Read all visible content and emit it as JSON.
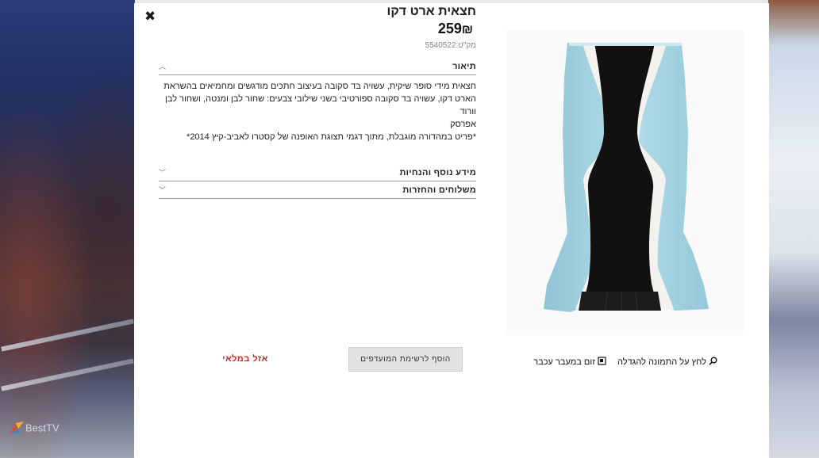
{
  "product": {
    "title": "חצאית ארט דקו",
    "price": "259",
    "currency": "₪",
    "sku": "מק\"ט:5540522"
  },
  "accordion": {
    "description": {
      "label": "תיאור",
      "line1": "חצאית מידי סופר שיקית, עשויה בד סקובה בעיצוב חתכים מודגשים ומחמיאים בהשראת",
      "line2": "הארט דקו, עשויה בד סקובה ספורטיבי בשני שילובי צבעים: שחור לבן ומנטה, ושחור לבן וורוד",
      "line3": "אפרסק",
      "line4": "*פריט במהדורה מוגבלת, מתוך דגמי תצוגת האופנה של קסטרו לאביב-קיץ 2014*"
    },
    "more_info": {
      "label": "מידע נוסף והנחיות"
    },
    "shipping": {
      "label": "משלוחים והחזרות"
    }
  },
  "image_controls": {
    "click_zoom": "לחץ על התמונה להגדלה",
    "hover_zoom": "זום במעבר עכבר"
  },
  "actions": {
    "wishlist": "הוסף לרשימת המועדפים",
    "out_of_stock": "אזל במלאי"
  },
  "brand": {
    "logo_text": "Best",
    "logo_text2": "TV"
  },
  "colors": {
    "mint": "#a9d7e4",
    "black": "#101010",
    "out_of_stock": "#d22020"
  }
}
